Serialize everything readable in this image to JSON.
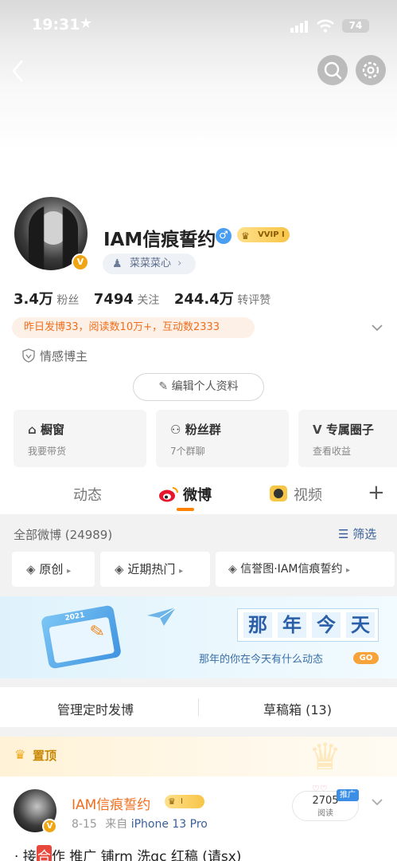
{
  "status_bar": {
    "time": "19:31",
    "battery": "74"
  },
  "profile": {
    "name": "IAM信痕誓约",
    "vip_badge": "VVIP I",
    "fan_group_pill": "菜菜菜心",
    "stats": [
      {
        "value": "3.4万",
        "label": "粉丝"
      },
      {
        "value": "7494",
        "label": "关注"
      },
      {
        "value": "244.4万",
        "label": "转评赞"
      }
    ],
    "activity": "昨日发博33，阅读数10万+，互动数2333",
    "tag": "情感博主",
    "edit_button": "编辑个人资料"
  },
  "cards": [
    {
      "title": "橱窗",
      "sub": "我要带货"
    },
    {
      "title": "粉丝群",
      "sub": "7个群聊"
    },
    {
      "title": "专属圈子",
      "sub": "查看收益"
    }
  ],
  "tabs": [
    "动态",
    "微博",
    "视频"
  ],
  "feed": {
    "all_count": "全部微博 (24989)",
    "filter": "筛选",
    "filters": [
      "原创",
      "近期热门",
      "信誉图·IAM信痕誓约"
    ]
  },
  "banner": {
    "chars": [
      "那",
      "年",
      "今",
      "天"
    ],
    "subtitle": "那年的你在今天有什么动态",
    "go": "GO",
    "calendar_year": "2021"
  },
  "manage": {
    "scheduled": "管理定时发博",
    "drafts": "草稿箱 (13)"
  },
  "pinned": {
    "label": "置顶",
    "author": "IAM信痕誓约",
    "vip_badge": "I",
    "meta_date": "8-15",
    "meta_source": "来自",
    "meta_device": "iPhone 13 Pro",
    "read_count": "2705",
    "read_label": "阅读",
    "promo_badge": "推广",
    "text_prefix": "· 接",
    "text_highlight": "合",
    "text_rest": "作 推广 铺rm 洗gc 红稿 (请sx)"
  },
  "colors": {
    "accent": "#ff8200",
    "link_blue": "#3a5f9a",
    "vip_gold": "#f7c548"
  }
}
